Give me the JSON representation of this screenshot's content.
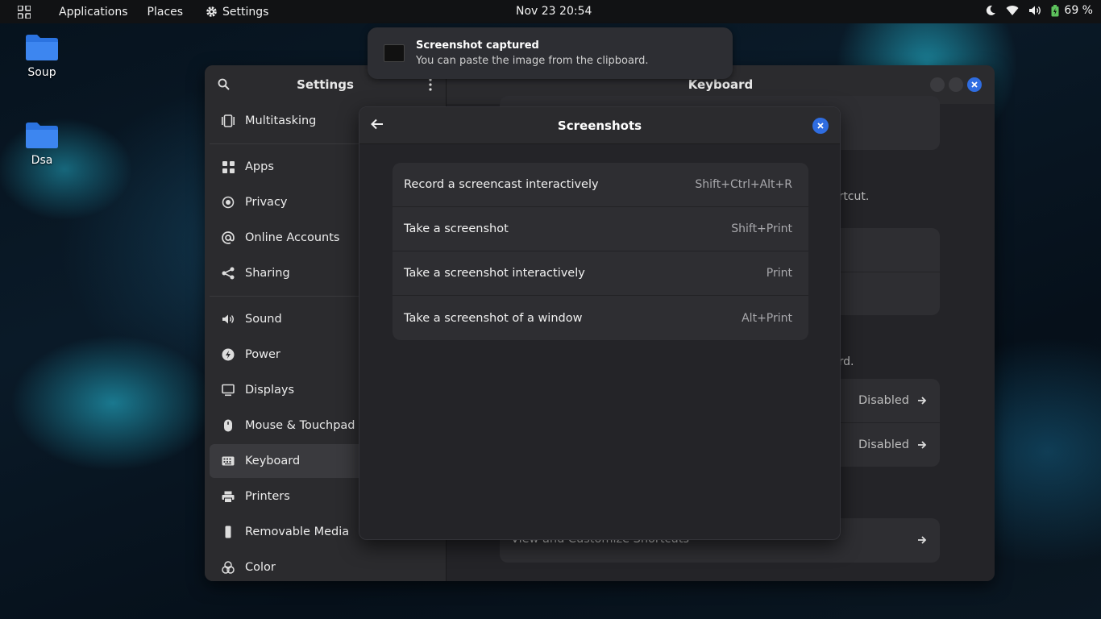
{
  "topbar": {
    "applications": "Applications",
    "places": "Places",
    "settings": "Settings",
    "clock": "Nov 23  20:54",
    "battery": "69 %"
  },
  "desktop": {
    "icons": [
      {
        "label": "Soup"
      },
      {
        "label": "Dsa"
      }
    ]
  },
  "notification": {
    "title": "Screenshot captured",
    "body": "You can paste the image from the clipboard."
  },
  "settings_window": {
    "sidebar_title": "Settings",
    "content_title": "Keyboard",
    "sidebar": {
      "items": [
        {
          "label": "Multitasking",
          "icon": "multitasking-icon"
        },
        {
          "label": "Apps",
          "icon": "apps-icon"
        },
        {
          "label": "Privacy",
          "icon": "privacy-icon"
        },
        {
          "label": "Online Accounts",
          "icon": "at-icon"
        },
        {
          "label": "Sharing",
          "icon": "share-icon"
        },
        {
          "label": "Sound",
          "icon": "sound-icon"
        },
        {
          "label": "Power",
          "icon": "power-icon"
        },
        {
          "label": "Displays",
          "icon": "display-icon"
        },
        {
          "label": "Mouse & Touchpad",
          "icon": "mouse-icon"
        },
        {
          "label": "Keyboard",
          "icon": "keyboard-icon"
        },
        {
          "label": "Printers",
          "icon": "printer-icon"
        },
        {
          "label": "Removable Media",
          "icon": "usb-icon"
        },
        {
          "label": "Color",
          "icon": "color-icon"
        }
      ]
    },
    "background_content": {
      "fragment_shortcut": "ortcut.",
      "fragment_board": "ard.",
      "disabled_1": "Disabled",
      "disabled_2": "Disabled",
      "view_shortcuts": "View and Customize Shortcuts"
    }
  },
  "dialog": {
    "title": "Screenshots",
    "shortcuts": [
      {
        "name": "Record a screencast interactively",
        "keys": "Shift+Ctrl+Alt+R"
      },
      {
        "name": "Take a screenshot",
        "keys": "Shift+Print"
      },
      {
        "name": "Take a screenshot interactively",
        "keys": "Print"
      },
      {
        "name": "Take a screenshot of a window",
        "keys": "Alt+Print"
      }
    ]
  },
  "colors": {
    "accent": "#2f6de1",
    "window_bg": "#222226",
    "sidebar_bg": "#2b2b2e"
  }
}
